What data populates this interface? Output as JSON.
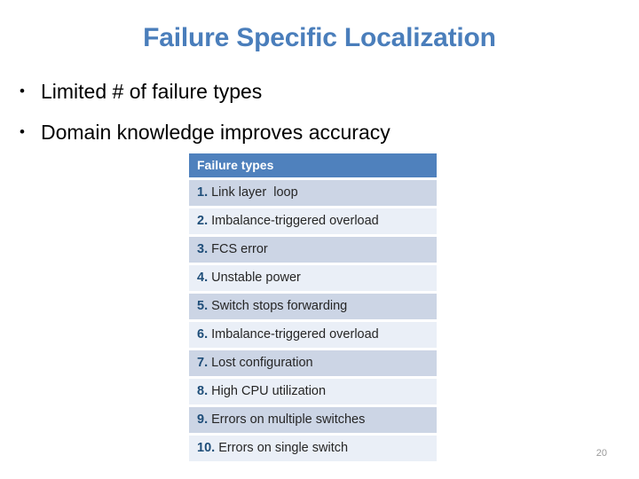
{
  "slide": {
    "title": "Failure Specific Localization",
    "page_number": "20",
    "accent_color": "#4a7ebb",
    "table_header_color": "#4f81bd",
    "row_odd_color": "#ccd5e5",
    "row_even_color": "#eaeff7",
    "number_color": "#1f4e79"
  },
  "bullets": [
    {
      "marker": "•",
      "text": "Limited # of failure types"
    },
    {
      "marker": "•",
      "text": "Domain knowledge improves accuracy"
    }
  ],
  "table": {
    "header": "Failure types",
    "rows": [
      {
        "number": "1.",
        "label": " Link layer  loop"
      },
      {
        "number": "2.",
        "label": " Imbalance-triggered overload"
      },
      {
        "number": "3.",
        "label": " FCS error"
      },
      {
        "number": "4.",
        "label": " Unstable power"
      },
      {
        "number": "5.",
        "label": " Switch stops forwarding"
      },
      {
        "number": "6.",
        "label": " Imbalance-triggered overload"
      },
      {
        "number": "7.",
        "label": " Lost configuration"
      },
      {
        "number": "8.",
        "label": " High CPU utilization"
      },
      {
        "number": "9.",
        "label": " Errors on multiple switches"
      },
      {
        "number": "10.",
        "label": " Errors on single switch"
      }
    ]
  }
}
